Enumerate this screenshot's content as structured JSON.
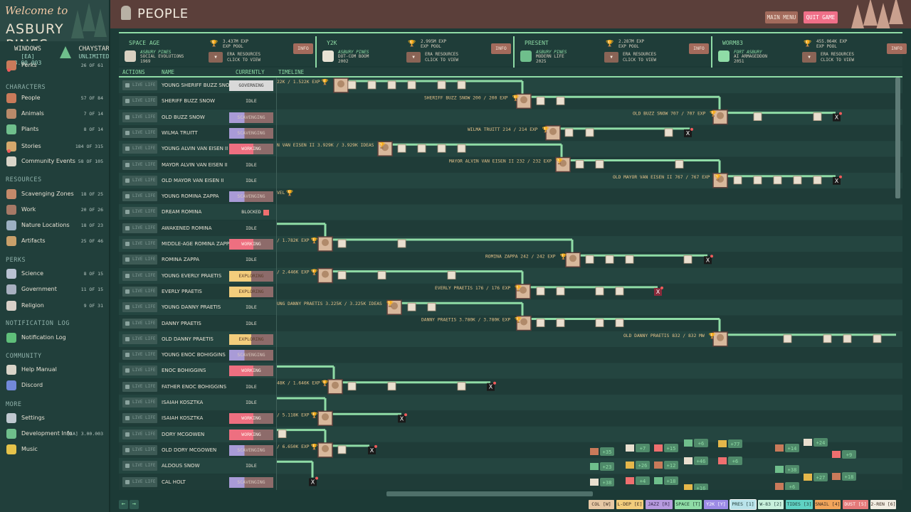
{
  "app": {
    "title_line1": "Welcome to",
    "title_line2": "ASBURY PINES",
    "platform": "WINDOWS",
    "version": "[EA] 3.00.003",
    "store": "CHAYSTAR",
    "store_sub": "UNLIMITED"
  },
  "sidebar": {
    "top_partial": {
      "label": "Perks",
      "count": "26 OF 61"
    },
    "sections": [
      {
        "label": "CHARACTERS"
      },
      {
        "label": "RESOURCES"
      },
      {
        "label": "PERKS"
      },
      {
        "label": "NOTIFICATION LOG"
      },
      {
        "label": "COMMUNITY"
      },
      {
        "label": "MORE"
      }
    ],
    "items": [
      {
        "label": "People",
        "count": "57 OF 84",
        "icon": "people-icon"
      },
      {
        "label": "Animals",
        "count": "7 OF 14",
        "icon": "animal-icon"
      },
      {
        "label": "Plants",
        "count": "8 OF 14",
        "icon": "plant-icon"
      },
      {
        "label": "Stories",
        "count": "184 OF 315",
        "icon": "story-icon"
      },
      {
        "label": "Community Events",
        "count": "58 OF 105",
        "icon": "event-icon"
      },
      {
        "label": "Scavenging Zones",
        "count": "18 OF 25",
        "icon": "scavenge-icon"
      },
      {
        "label": "Work",
        "count": "20 OF 26",
        "icon": "work-icon"
      },
      {
        "label": "Nature Locations",
        "count": "18 OF 23",
        "icon": "nature-icon"
      },
      {
        "label": "Artifacts",
        "count": "25 OF 46",
        "icon": "artifact-icon"
      },
      {
        "label": "Science",
        "count": "8 OF 15",
        "icon": "science-icon"
      },
      {
        "label": "Government",
        "count": "11 OF 15",
        "icon": "government-icon"
      },
      {
        "label": "Religion",
        "count": "9 OF 31",
        "icon": "religion-icon"
      },
      {
        "label": "Notification Log",
        "count": "",
        "icon": "notification-icon"
      },
      {
        "label": "Help Manual",
        "count": "",
        "icon": "help-icon"
      },
      {
        "label": "Discord",
        "count": "",
        "icon": "discord-icon"
      },
      {
        "label": "Settings",
        "count": "",
        "icon": "settings-icon"
      },
      {
        "label": "Development Info",
        "count": "[EA] 3.00.003",
        "icon": "terminal-icon"
      },
      {
        "label": "Music",
        "count": "",
        "icon": "music-icon"
      }
    ]
  },
  "header": {
    "title": "PEOPLE",
    "main_menu": "MAIN MENU",
    "quit_game": "QUIT GAME"
  },
  "eras": [
    {
      "name": "SPACE AGE",
      "town": "ASBURY PINES",
      "era": "SOCIAL EVOLUTIONS",
      "year": "1969",
      "pool": "3.437M EXP",
      "pool_label": "EXP POOL",
      "resources": "ERA RESOURCES",
      "resources_sub": "CLICK TO VIEW",
      "info": "INFO"
    },
    {
      "name": "Y2K",
      "town": "ASBURY PINES",
      "era": "DOT-COM BOOM",
      "year": "2002",
      "pool": "2.995M EXP",
      "pool_label": "EXP POOL",
      "resources": "ERA RESOURCES",
      "resources_sub": "CLICK TO VIEW",
      "info": "INFO"
    },
    {
      "name": "PRESENT",
      "town": "ASBURY PINES",
      "era": "MODERN LIFE",
      "year": "2025",
      "pool": "2.287M EXP",
      "pool_label": "EXP POOL",
      "resources": "ERA RESOURCES",
      "resources_sub": "CLICK TO VIEW",
      "info": "INFO"
    },
    {
      "name": "WORM83",
      "town": "FORT ASBURY",
      "era": "AI ARMAGEDDON",
      "year": "2051",
      "pool": "455.064K EXP",
      "pool_label": "EXP POOL",
      "resources": "ERA RESOURCES",
      "resources_sub": "CLICK TO VIEW",
      "info": "INFO"
    }
  ],
  "table": {
    "headers": {
      "actions": "ACTIONS",
      "name": "NAME",
      "currently": "CURRENTLY",
      "timeline": "TIMELINE"
    },
    "action_label": "LIVE LIFE",
    "rows": [
      {
        "name": "YOUNG SHERIFF BUZZ SNOW",
        "status": "GOVERNING",
        "kind": "governing"
      },
      {
        "name": "SHERIFF BUZZ SNOW",
        "status": "IDLE",
        "kind": "idle"
      },
      {
        "name": "OLD BUZZ SNOW",
        "status": "SCAVENGING",
        "kind": "scavenging"
      },
      {
        "name": "WILMA TRUITT",
        "status": "SCAVENGING",
        "kind": "scavenging"
      },
      {
        "name": "YOUNG ALVIN VAN EISEN II",
        "status": "WORKING",
        "kind": "working"
      },
      {
        "name": "MAYOR ALVIN VAN EISEN II",
        "status": "IDLE",
        "kind": "idle"
      },
      {
        "name": "OLD MAYOR VAN EISEN II",
        "status": "IDLE",
        "kind": "idle"
      },
      {
        "name": "YOUNG ROMINA ZAPPA",
        "status": "SCAVENGING",
        "kind": "scavenging"
      },
      {
        "name": "DREAM ROMINA",
        "status": "BLOCKED",
        "kind": "blocked"
      },
      {
        "name": "AWAKENED ROMINA",
        "status": "IDLE",
        "kind": "idle"
      },
      {
        "name": "MIDDLE-AGE ROMINA ZAPPA",
        "status": "WORKING",
        "kind": "working"
      },
      {
        "name": "ROMINA ZAPPA",
        "status": "IDLE",
        "kind": "idle"
      },
      {
        "name": "YOUNG EVERLY PRAETIS",
        "status": "EXPLORING",
        "kind": "exploring"
      },
      {
        "name": "EVERLY PRAETIS",
        "status": "EXPLORING",
        "kind": "exploring"
      },
      {
        "name": "YOUNG DANNY PRAETIS",
        "status": "IDLE",
        "kind": "idle"
      },
      {
        "name": "DANNY PRAETIS",
        "status": "IDLE",
        "kind": "idle"
      },
      {
        "name": "OLD DANNY PRAETIS",
        "status": "EXPLORING",
        "kind": "exploring"
      },
      {
        "name": "YOUNG ENOC BOHIGGINS",
        "status": "SCAVENGING",
        "kind": "scavenging"
      },
      {
        "name": "ENOC BOHIGGINS",
        "status": "WORKING",
        "kind": "working"
      },
      {
        "name": "FATHER ENOC BOHIGGINS",
        "status": "IDLE",
        "kind": "idle"
      },
      {
        "name": "ISAIAH KOSZTKA",
        "status": "IDLE",
        "kind": "idle"
      },
      {
        "name": "ISAIAH KOSZTKA",
        "status": "WORKING",
        "kind": "working"
      },
      {
        "name": "DORY MCGOWEN",
        "status": "WORKING",
        "kind": "working"
      },
      {
        "name": "OLD DORY MCGOWEN",
        "status": "SCAVENGING",
        "kind": "scavenging"
      },
      {
        "name": "ALDOUS SNOW",
        "status": "IDLE",
        "kind": "idle"
      },
      {
        "name": "CAL HOLT",
        "status": "SCAVENGING",
        "kind": "scavenging"
      }
    ]
  },
  "timeline": {
    "labels": [
      {
        "row": 0,
        "text": "22K / 1.522K EXP"
      },
      {
        "row": 1,
        "text": "SHERIFF BUZZ SNOW  200 / 200 EXP"
      },
      {
        "row": 2,
        "text": "OLD BUZZ SNOW  707 / 707 EXP"
      },
      {
        "row": 3,
        "text": "WILMA TRUITT  214 / 214 EXP"
      },
      {
        "row": 4,
        "text": "N VAN EISEN II  3.929K / 3.929K IDEAS"
      },
      {
        "row": 5,
        "text": "MAYOR ALVIN VAN EISEN II  232 / 232 EXP"
      },
      {
        "row": 6,
        "text": "OLD MAYOR VAN EISEN II  767 / 767 EXP"
      },
      {
        "row": 7,
        "text": "VEL"
      },
      {
        "row": 10,
        "text": "/ 1.782K EXP"
      },
      {
        "row": 11,
        "text": "ROMINA ZAPPA  242 / 242 EXP"
      },
      {
        "row": 12,
        "text": "/ 2.446K EXP"
      },
      {
        "row": 13,
        "text": "EVERLY PRAETIS  176 / 176 EXP"
      },
      {
        "row": 14,
        "text": "UNG DANNY PRAETIS  3.225K / 3.225K IDEAS"
      },
      {
        "row": 15,
        "text": "DANNY PRAETIS  3.780K / 3.780K EXP"
      },
      {
        "row": 16,
        "text": "OLD DANNY PRAETIS  832 / 832 MW"
      },
      {
        "row": 19,
        "text": "48K / 1.646K EXP"
      },
      {
        "row": 21,
        "text": "/ 5.118K EXP"
      },
      {
        "row": 23,
        "text": "/ 6.650K EXP"
      }
    ],
    "resource_counts": [
      "+35",
      "+7",
      "+15",
      "+6",
      "+77",
      "+14",
      "+24",
      "+9",
      "+23",
      "+26",
      "+12",
      "+46",
      "+6",
      "+38",
      "+27",
      "+18",
      "+38",
      "+4",
      "+18",
      "+16",
      "+6",
      "+25",
      "+4",
      "+6"
    ]
  },
  "era_tabs": [
    {
      "label": "COL [W]",
      "bg": "#e7c8a5",
      "fg": "#3b2a20"
    },
    {
      "label": "L-DEP [E]",
      "bg": "#f3cd7c",
      "fg": "#3b2a20"
    },
    {
      "label": "JAZZ [R]",
      "bg": "#b79be0",
      "fg": "#2d1f44"
    },
    {
      "label": "SPACE [T]",
      "bg": "#8fdca6",
      "fg": "#1b3a2c"
    },
    {
      "label": "Y2K [Y]",
      "bg": "#9c8be6",
      "fg": "#ffffff"
    },
    {
      "label": "PRES [1]",
      "bg": "#b9e3ea",
      "fg": "#1f3c38"
    },
    {
      "label": "W-83 [2]",
      "bg": "#c8f0dc",
      "fg": "#1f3c38"
    },
    {
      "label": "TIDES [3]",
      "bg": "#5fd2c4",
      "fg": "#1f3c38"
    },
    {
      "label": "SNAIL [4]",
      "bg": "#f2a55b",
      "fg": "#3b2a20"
    },
    {
      "label": "DUST [5]",
      "bg": "#e57a7a",
      "fg": "#ffffff"
    },
    {
      "label": "2-REN [6]",
      "bg": "#f1ece2",
      "fg": "#3b2a20"
    }
  ],
  "colors": {
    "accent_green": "#8fdca6",
    "bg_dark": "#1f3c38",
    "header_brown": "#5b3f3a",
    "quit_pink": "#ef6f88"
  }
}
